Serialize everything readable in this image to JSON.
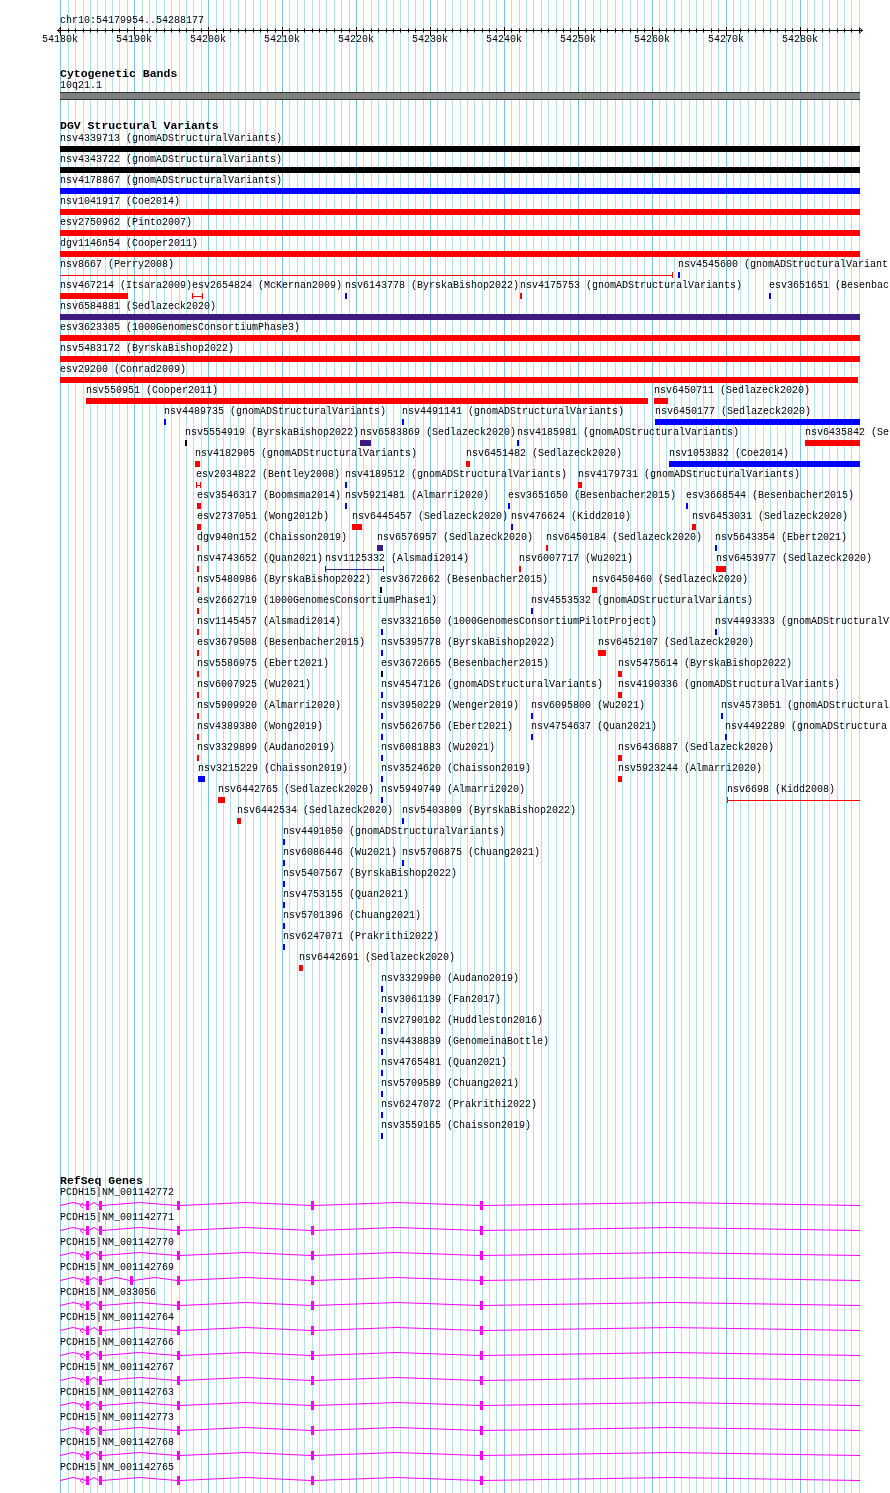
{
  "ruler": {
    "title": "chr10:54179954..54288177",
    "ticks": [
      "54180k",
      "54190k",
      "54200k",
      "54210k",
      "54220k",
      "54230k",
      "54240k",
      "54250k",
      "54260k",
      "54270k",
      "54280k"
    ]
  },
  "cytogenetic_bands": {
    "title": "Cytogenetic Bands",
    "bands": [
      {
        "label": "10q21.1"
      }
    ]
  },
  "dgv": {
    "title": "DGV Structural Variants",
    "lanes": [
      {
        "features": [
          {
            "label": "nsv4339713 (gnomADStructuralVariants)",
            "kind": "block",
            "color": "#000000"
          }
        ]
      },
      {
        "features": [
          {
            "label": "nsv4343722 (gnomADStructuralVariants)",
            "kind": "block",
            "color": "#000000"
          }
        ]
      },
      {
        "features": [
          {
            "label": "nsv4178867 (gnomADStructuralVariants)",
            "kind": "block",
            "color": "#0000ff"
          }
        ]
      },
      {
        "features": [
          {
            "label": "nsv1041917 (Coe2014)",
            "kind": "block",
            "color": "#ff0000"
          }
        ]
      },
      {
        "features": [
          {
            "label": "esv2750962 (Pinto2007)",
            "kind": "block",
            "color": "#ff0000"
          }
        ]
      },
      {
        "features": [
          {
            "label": "dgv1146n54 (Cooper2011)",
            "kind": "block",
            "color": "#ff0000"
          }
        ]
      },
      {
        "features": [
          {
            "label": "nsv8667 (Perry2008)",
            "kind": "span",
            "color": "#ff0000"
          },
          {
            "label": "nsv4545600 (gnomADStructuralVariant",
            "kind": "block",
            "color": "#0000ff"
          }
        ]
      },
      {
        "features": [
          {
            "label": "nsv467214 (Itsara2009)",
            "kind": "block",
            "color": "#ff0000"
          },
          {
            "label": "esv2654824 (McKernan2009)",
            "kind": "span",
            "color": "#ff0000"
          },
          {
            "label": "nsv6143778 (ByrskaBishop2022)",
            "kind": "block",
            "color": "#0000ff"
          },
          {
            "label": "nsv4175753 (gnomADStructuralVariants)",
            "kind": "block",
            "color": "#ff0000"
          },
          {
            "label": "esv3651651 (Besenbac",
            "kind": "block",
            "color": "#0000ff"
          }
        ]
      },
      {
        "features": [
          {
            "label": "nsv6584881 (Sedlazeck2020)",
            "kind": "block",
            "color": "#3d1a80"
          }
        ]
      },
      {
        "features": [
          {
            "label": "esv3623305 (1000GenomesConsortiumPhase3)",
            "kind": "block",
            "color": "#ff0000"
          }
        ]
      },
      {
        "features": [
          {
            "label": "nsv5483172 (ByrskaBishop2022)",
            "kind": "block",
            "color": "#ff0000"
          }
        ]
      },
      {
        "features": [
          {
            "label": "esv29200 (Conrad2009)",
            "kind": "block",
            "color": "#ff0000"
          }
        ]
      },
      {
        "features": [
          {
            "label": "nsv550951 (Cooper2011)",
            "kind": "block",
            "color": "#ff0000"
          },
          {
            "label": "nsv6450711 (Sedlazeck2020)",
            "kind": "block",
            "color": "#ff0000"
          }
        ]
      },
      {
        "features": [
          {
            "label": "nsv4489735 (gnomADStructuralVariants)",
            "kind": "block",
            "color": "#0000ff"
          },
          {
            "label": "nsv4491141 (gnomADStructuralVariants)",
            "kind": "block",
            "color": "#0000ff"
          },
          {
            "label": "nsv6450177 (Sedlazeck2020)",
            "kind": "block",
            "color": "#0000ff"
          }
        ]
      },
      {
        "features": [
          {
            "label": "nsv5554919 (ByrskaBishop2022)",
            "kind": "block",
            "color": "#000000"
          },
          {
            "label": "nsv6583869 (Sedlazeck2020)",
            "kind": "block",
            "color": "#3d1a80"
          },
          {
            "label": "nsv4185981 (gnomADStructuralVariants)",
            "kind": "block",
            "color": "#0000ff"
          },
          {
            "label": "nsv6435842 (Se",
            "kind": "block",
            "color": "#ff0000"
          }
        ]
      },
      {
        "features": [
          {
            "label": "nsv4182905 (gnomADStructuralVariants)",
            "kind": "block",
            "color": "#ff0000"
          },
          {
            "label": "nsv6451482 (Sedlazeck2020)",
            "kind": "block",
            "color": "#ff0000"
          },
          {
            "label": "nsv1053832 (Coe2014)",
            "kind": "block",
            "color": "#0000ff"
          }
        ]
      },
      {
        "features": [
          {
            "label": "esv2034822 (Bentley2008)",
            "kind": "span",
            "color": "#ff0000"
          },
          {
            "label": "nsv4189512 (gnomADStructuralVariants)",
            "kind": "block",
            "color": "#0000ff"
          },
          {
            "label": "nsv4179731 (gnomADStructuralVariants)",
            "kind": "block",
            "color": "#ff0000"
          }
        ]
      },
      {
        "features": [
          {
            "label": "esv3546317 (Boomsma2014)",
            "kind": "block",
            "color": "#ff0000"
          },
          {
            "label": "nsv5921481 (Almarri2020)",
            "kind": "block",
            "color": "#0000ff"
          },
          {
            "label": "esv3651650 (Besenbacher2015)",
            "kind": "block",
            "color": "#0000ff"
          },
          {
            "label": "esv3668544 (Besenbacher2015)",
            "kind": "block",
            "color": "#0000ff"
          }
        ]
      },
      {
        "features": [
          {
            "label": "esv2737051 (Wong2012b)",
            "kind": "block",
            "color": "#ff0000"
          },
          {
            "label": "nsv6445457 (Sedlazeck2020)",
            "kind": "block",
            "color": "#ff0000"
          },
          {
            "label": "nsv476624 (Kidd2010)",
            "kind": "block",
            "color": "#0000ff"
          },
          {
            "label": "nsv6453031 (Sedlazeck2020)",
            "kind": "block",
            "color": "#ff0000"
          }
        ]
      },
      {
        "features": [
          {
            "label": "dgv940n152 (Chaisson2019)",
            "kind": "block",
            "color": "#ff0000"
          },
          {
            "label": "nsv6576957 (Sedlazeck2020)",
            "kind": "block",
            "color": "#3d1a80"
          },
          {
            "label": "nsv6450184 (Sedlazeck2020)",
            "kind": "block",
            "color": "#ff0000"
          },
          {
            "label": "nsv5643354 (Ebert2021)",
            "kind": "block",
            "color": "#0000ff"
          }
        ]
      },
      {
        "features": [
          {
            "label": "nsv4743652 (Quan2021)",
            "kind": "block",
            "color": "#ff0000"
          },
          {
            "label": "nsv1125332 (Alsmadi2014)",
            "kind": "span",
            "color": "#3d1a80"
          },
          {
            "label": "nsv6007717 (Wu2021)",
            "kind": "block",
            "color": "#ff0000"
          },
          {
            "label": "nsv6453977 (Sedlazeck2020)",
            "kind": "block",
            "color": "#ff0000"
          }
        ]
      },
      {
        "features": [
          {
            "label": "nsv5480986 (ByrskaBishop2022)",
            "kind": "block",
            "color": "#ff0000"
          },
          {
            "label": "esv3672662 (Besenbacher2015)",
            "kind": "block",
            "color": "#000000"
          },
          {
            "label": "nsv6450460 (Sedlazeck2020)",
            "kind": "block",
            "color": "#ff0000"
          }
        ]
      },
      {
        "features": [
          {
            "label": "esv2662719 (1000GenomesConsortiumPhase1)",
            "kind": "block",
            "color": "#ff0000"
          },
          {
            "label": "nsv4553532 (gnomADStructuralVariants)",
            "kind": "block",
            "color": "#0000ff"
          }
        ]
      },
      {
        "features": [
          {
            "label": "nsv1145457 (Alsmadi2014)",
            "kind": "block",
            "color": "#ff0000"
          },
          {
            "label": "esv3321650 (1000GenomesConsortiumPilotProject)",
            "kind": "block",
            "color": "#0000ff"
          },
          {
            "label": "nsv4493333 (gnomADStructuralV",
            "kind": "block",
            "color": "#0000ff"
          }
        ]
      },
      {
        "features": [
          {
            "label": "esv3679508 (Besenbacher2015)",
            "kind": "block",
            "color": "#ff0000"
          },
          {
            "label": "nsv5395778 (ByrskaBishop2022)",
            "kind": "block",
            "color": "#0000ff"
          },
          {
            "label": "nsv6452107 (Sedlazeck2020)",
            "kind": "block",
            "color": "#ff0000"
          }
        ]
      },
      {
        "features": [
          {
            "label": "nsv5586975 (Ebert2021)",
            "kind": "block",
            "color": "#ff0000"
          },
          {
            "label": "esv3672665 (Besenbacher2015)",
            "kind": "block",
            "color": "#000000"
          },
          {
            "label": "nsv5475614 (ByrskaBishop2022)",
            "kind": "block",
            "color": "#ff0000"
          }
        ]
      },
      {
        "features": [
          {
            "label": "nsv6007925 (Wu2021)",
            "kind": "block",
            "color": "#ff0000"
          },
          {
            "label": "nsv4547126 (gnomADStructuralVariants)",
            "kind": "block",
            "color": "#0000ff"
          },
          {
            "label": "nsv4190336 (gnomADStructuralVariants)",
            "kind": "block",
            "color": "#ff0000"
          }
        ]
      },
      {
        "features": [
          {
            "label": "nsv5909920 (Almarri2020)",
            "kind": "block",
            "color": "#ff0000"
          },
          {
            "label": "nsv3950229 (Wenger2019)",
            "kind": "block",
            "color": "#0000ff"
          },
          {
            "label": "nsv6095800 (Wu2021)",
            "kind": "block",
            "color": "#0000ff"
          },
          {
            "label": "nsv4573051 (gnomADStructural",
            "kind": "block",
            "color": "#0000ff"
          }
        ]
      },
      {
        "features": [
          {
            "label": "nsv4389380 (Wong2019)",
            "kind": "block",
            "color": "#ff0000"
          },
          {
            "label": "nsv5626756 (Ebert2021)",
            "kind": "block",
            "color": "#0000ff"
          },
          {
            "label": "nsv4754637 (Quan2021)",
            "kind": "block",
            "color": "#0000ff"
          },
          {
            "label": "nsv4492289 (gnomADStructura",
            "kind": "block",
            "color": "#0000ff"
          }
        ]
      },
      {
        "features": [
          {
            "label": "nsv3329899 (Audano2019)",
            "kind": "block",
            "color": "#ff0000"
          },
          {
            "label": "nsv6081883 (Wu2021)",
            "kind": "block",
            "color": "#0000ff"
          },
          {
            "label": "nsv6436887 (Sedlazeck2020)",
            "kind": "block",
            "color": "#ff0000"
          }
        ]
      },
      {
        "features": [
          {
            "label": "nsv3215229 (Chaisson2019)",
            "kind": "block",
            "color": "#0000ff"
          },
          {
            "label": "nsv3524620 (Chaisson2019)",
            "kind": "block",
            "color": "#0000ff"
          },
          {
            "label": "nsv5923244 (Almarri2020)",
            "kind": "block",
            "color": "#ff0000"
          }
        ]
      },
      {
        "features": [
          {
            "label": "nsv6442765 (Sedlazeck2020)",
            "kind": "block",
            "color": "#ff0000"
          },
          {
            "label": "nsv5949749 (Almarri2020)",
            "kind": "block",
            "color": "#0000ff"
          },
          {
            "label": "nsv6698 (Kidd2008)",
            "kind": "span",
            "color": "#ff0000"
          }
        ]
      },
      {
        "features": [
          {
            "label": "nsv6442534 (Sedlazeck2020)",
            "kind": "block",
            "color": "#ff0000"
          },
          {
            "label": "nsv5403809 (ByrskaBishop2022)",
            "kind": "block",
            "color": "#0000ff"
          }
        ]
      },
      {
        "features": [
          {
            "label": "nsv4491050 (gnomADStructuralVariants)",
            "kind": "block",
            "color": "#0000ff"
          }
        ]
      },
      {
        "features": [
          {
            "label": "nsv6086446 (Wu2021)",
            "kind": "block",
            "color": "#0000ff"
          },
          {
            "label": "nsv5706875 (Chuang2021)",
            "kind": "block",
            "color": "#0000ff"
          }
        ]
      },
      {
        "features": [
          {
            "label": "nsv5407567 (ByrskaBishop2022)",
            "kind": "block",
            "color": "#0000ff"
          }
        ]
      },
      {
        "features": [
          {
            "label": "nsv4753155 (Quan2021)",
            "kind": "block",
            "color": "#0000ff"
          }
        ]
      },
      {
        "features": [
          {
            "label": "nsv5701396 (Chuang2021)",
            "kind": "block",
            "color": "#0000ff"
          }
        ]
      },
      {
        "features": [
          {
            "label": "nsv6247071 (Prakrithi2022)",
            "kind": "block",
            "color": "#0000ff"
          }
        ]
      },
      {
        "features": [
          {
            "label": "nsv6442691 (Sedlazeck2020)",
            "kind": "block",
            "color": "#ff0000"
          }
        ]
      },
      {
        "features": [
          {
            "label": "nsv3329900 (Audano2019)",
            "kind": "block",
            "color": "#0000ff"
          }
        ]
      },
      {
        "features": [
          {
            "label": "nsv3061139 (Fan2017)",
            "kind": "block",
            "color": "#0000ff"
          }
        ]
      },
      {
        "features": [
          {
            "label": "nsv2790102 (Huddleston2016)",
            "kind": "block",
            "color": "#0000ff"
          }
        ]
      },
      {
        "features": [
          {
            "label": "nsv4438839 (GenomeinaBottle)",
            "kind": "block",
            "color": "#0000ff"
          }
        ]
      },
      {
        "features": [
          {
            "label": "nsv4765481 (Quan2021)",
            "kind": "block",
            "color": "#0000ff"
          }
        ]
      },
      {
        "features": [
          {
            "label": "nsv5709589 (Chuang2021)",
            "kind": "block",
            "color": "#0000ff"
          }
        ]
      },
      {
        "features": [
          {
            "label": "nsv6247072 (Prakrithi2022)",
            "kind": "block",
            "color": "#0000ff"
          }
        ]
      },
      {
        "features": [
          {
            "label": "nsv3559165 (Chaisson2019)",
            "kind": "block",
            "color": "#0000ff"
          }
        ]
      }
    ]
  },
  "refseq_genes": {
    "title": "RefSeq Genes",
    "transcripts": [
      {
        "label": "PCDH15|NM_001142772"
      },
      {
        "label": "PCDH15|NM_001142771"
      },
      {
        "label": "PCDH15|NM_001142770"
      },
      {
        "label": "PCDH15|NM_001142769"
      },
      {
        "label": "PCDH15|NM_033056"
      },
      {
        "label": "PCDH15|NM_001142764"
      },
      {
        "label": "PCDH15|NM_001142766"
      },
      {
        "label": "PCDH15|NM_001142767"
      },
      {
        "label": "PCDH15|NM_001142763"
      },
      {
        "label": "PCDH15|NM_001142773"
      },
      {
        "label": "PCDH15|NM_001142768"
      },
      {
        "label": "PCDH15|NM_001142765"
      }
    ]
  }
}
